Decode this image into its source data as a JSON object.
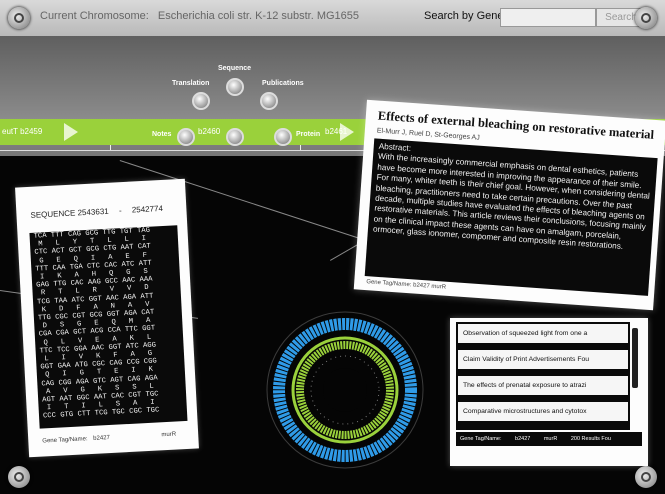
{
  "header": {
    "chromosome_label": "Current Chromosome:",
    "chromosome_value": "Escherichia coli str. K-12 substr. MG1655",
    "search_label": "Search by Gene",
    "search_value": "",
    "search_button": "Search"
  },
  "ruler": {
    "ticks": [
      "2572000",
      "2573000",
      "2574000"
    ]
  },
  "genes": {
    "left": "eutT  b2459",
    "center": "b2460",
    "right": "b2461"
  },
  "context_menu": {
    "top": "Sequence",
    "left": "Translation",
    "right": "Publications",
    "far_left": "Notes",
    "far_right": "Protein"
  },
  "sequence_panel": {
    "title_prefix": "SEQUENCE",
    "start": "2543631",
    "separator": "-",
    "end": "2542774",
    "lines": [
      "TCA TTT CAG GCG TTG TGT TAG",
      " M   L   Y   T   L   L   I",
      "CTC ACT GCT GCG CTG AAT CAT",
      " G   E   Q   I   A   E   F",
      "TTT CAA TGA CTC CAC ATC ATT",
      " I   K   A   H   Q   G   S",
      "GAG TTG CAC AAG GCC AAC AAA",
      " R   T   L   R   V   V   D",
      "TCG TAA ATC GGT AAC AGA ATT",
      " K   D   F   A   N   A   V",
      "TTG CGC CGT GCG GGT AGA CAT",
      " D   S   G   E   Q   M   A",
      "CGA CGA GCT ACG CCA TTC GGT",
      " Q   L   V   E   A   K   L",
      "TTC TCC GGA AAC GGT ATC AGG",
      " L   I   V   K   F   A   G",
      "GGT GAA ATG CGC CAG CCG CGG",
      " Q   I   G   T   E   I   K",
      "CAG CGG AGA GTC AGT CAG AGA",
      " A   V   G   K   S   S   L",
      "AGT AAT GGC AAT CAC CGT TGC",
      " I   T   I   L   S   A   I",
      "CCC GTG CTT TCG TGC CGC TGC"
    ],
    "footer_label": "Gene Tag/Name:",
    "footer_tag": "b2427",
    "footer_name": "murR"
  },
  "abstract_panel": {
    "title": "Effects of external bleaching on restorative material",
    "authors": "El-Murr J, Ruel D, St-Georges AJ",
    "heading": "Abstract:",
    "body": "With the increasingly commercial emphasis on dental esthetics, patients have become more interested in improving the appearance of their smile. For many, whiter teeth is their chief goal. However, when considering dental bleaching, practitioners need to take certain precautions. Over the past decade, multiple studies have evaluated the effects of bleaching agents on restorative materials. This article reviews their conclusions, focusing mainly on the clinical impact these agents can have on amalgam, porcelain, ormocer, glass ionomer, compomer and composite resin restorations.",
    "footer": "Gene Tag/Name:  b2427   murR"
  },
  "results_panel": {
    "items": [
      "Observation of squeezed light from one a",
      "Claim Validity of Print Advertisements Fou",
      "The effects of prenatal exposure to atrazi",
      "Comparative microstructures and cytotox"
    ],
    "footer_label": "Gene Tag/Name:",
    "footer_tag": "b2427",
    "footer_name": "murR",
    "footer_count": "200 Results Fou"
  },
  "colors": {
    "gene_green": "#9ad13b",
    "ring_blue": "#2f9be8",
    "ring_green": "#9ad13b",
    "band_gray": "#7a7a7a"
  },
  "icons": [
    "corner-orb-icon",
    "menu-orb-icon"
  ]
}
